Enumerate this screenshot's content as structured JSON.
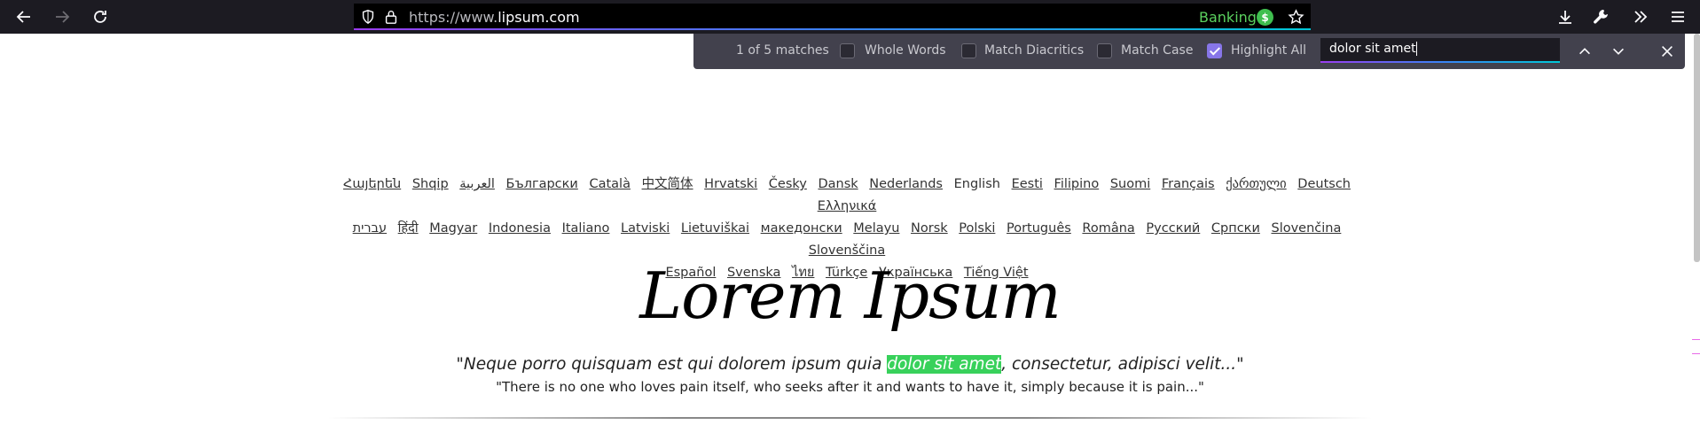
{
  "browser": {
    "url_scheme_prefix": "https://www.",
    "url_host": "lipsum.com",
    "banking_label": "Banking",
    "banking_badge": "$"
  },
  "findbar": {
    "match_status": "1 of 5 matches",
    "whole_words": {
      "label": "Whole Words",
      "checked": false
    },
    "match_diacritics": {
      "label": "Match Diacritics",
      "checked": false
    },
    "match_case": {
      "label": "Match Case",
      "checked": false
    },
    "highlight_all": {
      "label": "Highlight All",
      "checked": true
    },
    "query": "dolor sit amet"
  },
  "languages": [
    "Հայերեն",
    "Shqip",
    "العربية",
    "Български",
    "Català",
    "中文简体",
    "Hrvatski",
    "Česky",
    "Dansk",
    "Nederlands",
    "English",
    "Eesti",
    "Filipino",
    "Suomi",
    "Français",
    "ქართული",
    "Deutsch",
    "Ελληνικά",
    "עברית",
    "हिंदी",
    "Magyar",
    "Indonesia",
    "Italiano",
    "Latviski",
    "Lietuviškai",
    "македонски",
    "Melayu",
    "Norsk",
    "Polski",
    "Português",
    "Româna",
    "Pусский",
    "Српски",
    "Slovenčina",
    "Slovenščina",
    "Español",
    "Svenska",
    "ไทย",
    "Türkçe",
    "Українська",
    "Tiếng Việt"
  ],
  "main": {
    "title": "Lorem Ipsum",
    "quote_before": "\"Neque porro quisquam est qui dolorem ipsum quia ",
    "quote_highlight": "dolor sit amet",
    "quote_after": ", consectetur, adipisci velit...\"",
    "translation": "\"There is no one who loves pain itself, who seeks after it and wants to have it, simply because it is pain...\""
  }
}
